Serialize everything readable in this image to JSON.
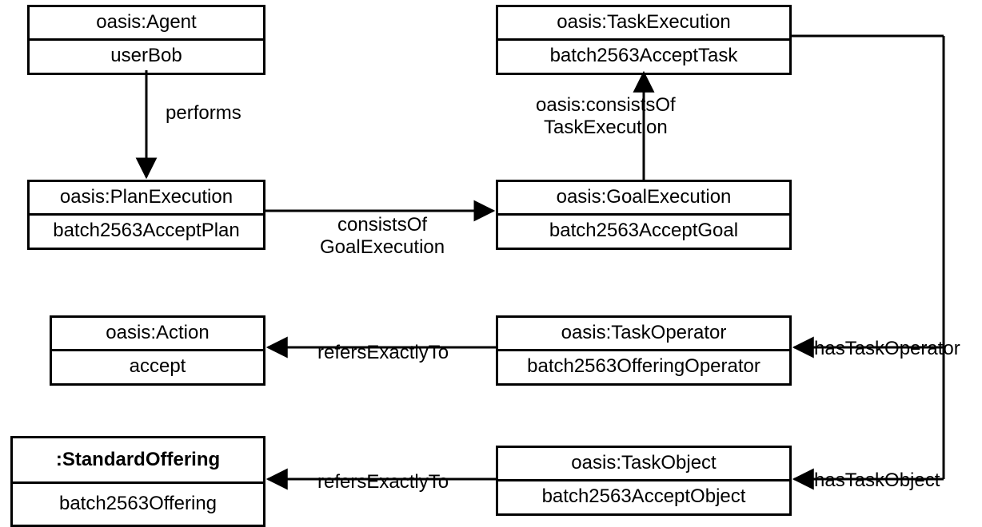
{
  "nodes": {
    "agent": {
      "type": "oasis:Agent",
      "instance": "userBob"
    },
    "taskExecution": {
      "type": "oasis:TaskExecution",
      "instance": "batch2563AcceptTask"
    },
    "planExecution": {
      "type": "oasis:PlanExecution",
      "instance": "batch2563AcceptPlan"
    },
    "goalExecution": {
      "type": "oasis:GoalExecution",
      "instance": "batch2563AcceptGoal"
    },
    "action": {
      "type": "oasis:Action",
      "instance": "accept"
    },
    "taskOperator": {
      "type": "oasis:TaskOperator",
      "instance": "batch2563OfferingOperator"
    },
    "standardOffering": {
      "type": ":StandardOffering",
      "instance": "batch2563Offering"
    },
    "taskObject": {
      "type": "oasis:TaskObject",
      "instance": "batch2563AcceptObject"
    }
  },
  "edges": {
    "performs": "performs",
    "consistsOfGoalExecution_l1": "consistsOf",
    "consistsOfGoalExecution_l2": "GoalExecution",
    "consistsOfTaskExecution_l1": "oasis:consistsOf",
    "consistsOfTaskExecution_l2": "TaskExecution",
    "hasTaskOperator": "hasTaskOperator",
    "hasTaskObject": "hasTaskObject",
    "refersExactlyTo_action": "refersExactlyTo",
    "refersExactlyTo_offer": "refersExactlyTo"
  }
}
